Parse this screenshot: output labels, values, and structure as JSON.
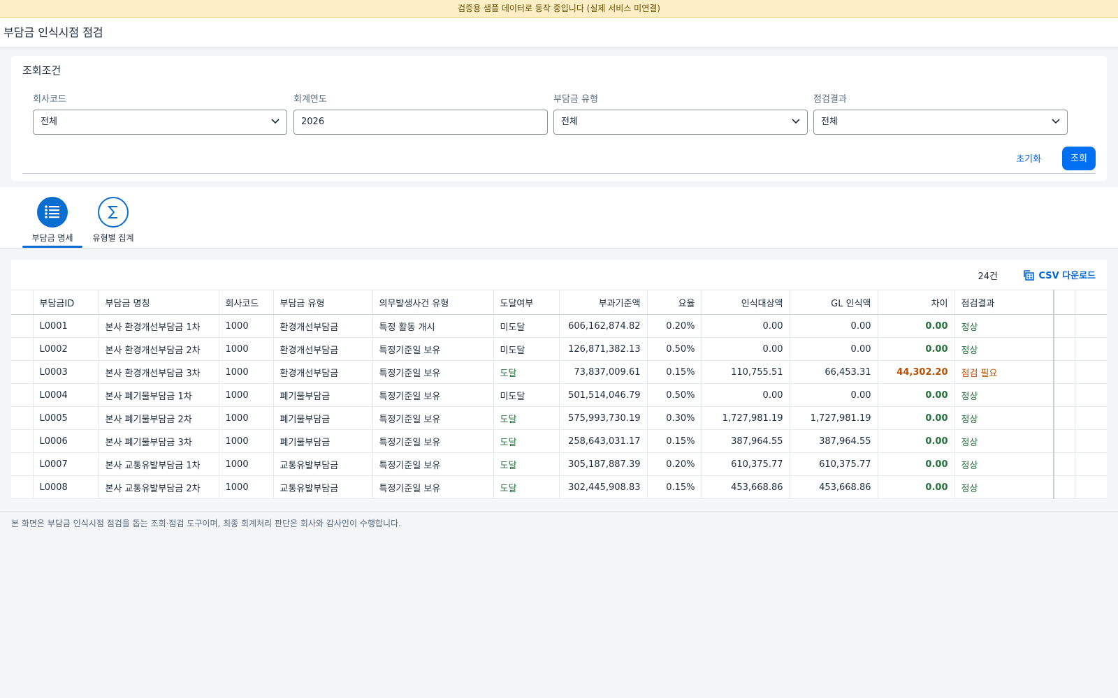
{
  "banner": "검증용 샘플 데이터로 동작 중입니다 (실제 서비스 미연결)",
  "page_title": "부담금 인식시점 점검",
  "filters": {
    "title": "조회조건",
    "fields": [
      {
        "label": "회사코드",
        "value": "전체",
        "type": "select"
      },
      {
        "label": "회계연도",
        "value": "2026",
        "type": "input"
      },
      {
        "label": "부담금 유형",
        "value": "전체",
        "type": "select"
      },
      {
        "label": "점검결과",
        "value": "전체",
        "type": "select"
      }
    ],
    "reset_label": "초기화",
    "search_label": "조회"
  },
  "tabs": [
    {
      "label": "부담금 명세",
      "icon": "list-icon",
      "active": true
    },
    {
      "label": "유형별 집계",
      "icon": "sigma-icon",
      "active": false
    }
  ],
  "table": {
    "count": "24건",
    "csv_label": "CSV 다운로드",
    "columns": [
      "부담금ID",
      "부담금 명칭",
      "회사코드",
      "부담금 유형",
      "의무발생사건 유형",
      "도달여부",
      "부과기준액",
      "요율",
      "인식대상액",
      "GL 인식액",
      "차이",
      "점검결과"
    ],
    "rows": [
      [
        "L0001",
        "본사 환경개선부담금 1차",
        "1000",
        "환경개선부담금",
        "특정 활동 개시",
        "미도달",
        "606,162,874.82",
        "0.20%",
        "0.00",
        "0.00",
        "0.00",
        "정상"
      ],
      [
        "L0002",
        "본사 환경개선부담금 2차",
        "1000",
        "환경개선부담금",
        "특정기준일 보유",
        "미도달",
        "126,871,382.13",
        "0.50%",
        "0.00",
        "0.00",
        "0.00",
        "정상"
      ],
      [
        "L0003",
        "본사 환경개선부담금 3차",
        "1000",
        "환경개선부담금",
        "특정기준일 보유",
        "도달",
        "73,837,009.61",
        "0.15%",
        "110,755.51",
        "66,453.31",
        "44,302.20",
        "점검 필요"
      ],
      [
        "L0004",
        "본사 폐기물부담금 1차",
        "1000",
        "폐기물부담금",
        "특정기준일 보유",
        "미도달",
        "501,514,046.79",
        "0.50%",
        "0.00",
        "0.00",
        "0.00",
        "정상"
      ],
      [
        "L0005",
        "본사 폐기물부담금 2차",
        "1000",
        "폐기물부담금",
        "특정기준일 보유",
        "도달",
        "575,993,730.19",
        "0.30%",
        "1,727,981.19",
        "1,727,981.19",
        "0.00",
        "정상"
      ],
      [
        "L0006",
        "본사 폐기물부담금 3차",
        "1000",
        "폐기물부담금",
        "특정기준일 보유",
        "도달",
        "258,643,031.17",
        "0.15%",
        "387,964.55",
        "387,964.55",
        "0.00",
        "정상"
      ],
      [
        "L0007",
        "본사 교통유발부담금 1차",
        "1000",
        "교통유발부담금",
        "특정기준일 보유",
        "도달",
        "305,187,887.39",
        "0.20%",
        "610,375.77",
        "610,375.77",
        "0.00",
        "정상"
      ],
      [
        "L0008",
        "본사 교통유발부담금 2차",
        "1000",
        "교통유발부담금",
        "특정기준일 보유",
        "도달",
        "302,445,908.83",
        "0.15%",
        "453,668.86",
        "453,668.86",
        "0.00",
        "정상"
      ]
    ]
  },
  "footer": "본 화면은 부담금 인식시점 점검을 돕는 조회·점검 도구이며, 최종 회계처리 판단은 회사와 감사인이 수행합니다.",
  "colors": {
    "accent": "#0a6ed1",
    "ok": "#256f3a",
    "warn": "#b95000",
    "banner_bg": "#fcefc6"
  }
}
